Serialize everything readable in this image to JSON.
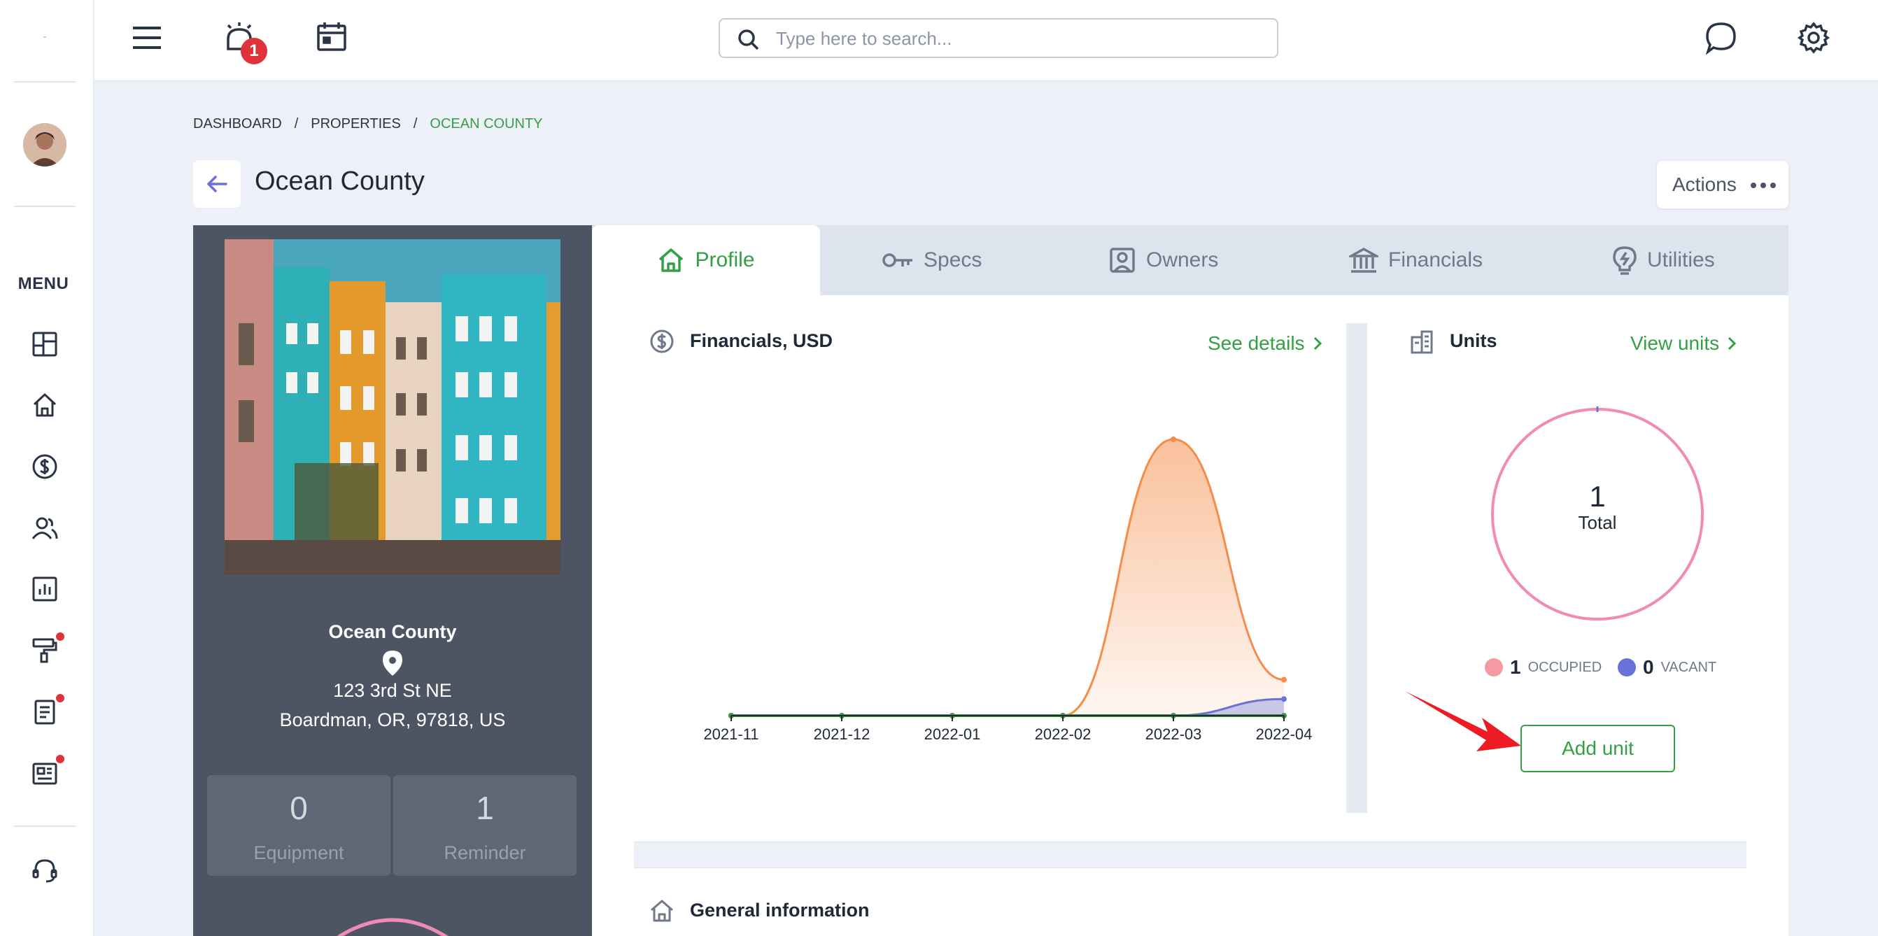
{
  "search": {
    "placeholder": "Type here to search..."
  },
  "topbar": {
    "alarm_badge": "1"
  },
  "sidebar": {
    "menu_label": "MENU",
    "items": [
      {
        "icon": "dashboard-icon"
      },
      {
        "icon": "home-icon"
      },
      {
        "icon": "dollar-icon"
      },
      {
        "icon": "users-icon"
      },
      {
        "icon": "chart-icon",
        "badge": false
      },
      {
        "icon": "paint-roller-icon",
        "badge": true
      },
      {
        "icon": "document-icon",
        "badge": true
      },
      {
        "icon": "newspaper-icon",
        "badge": true
      },
      {
        "icon": "support-icon"
      }
    ]
  },
  "breadcrumb": {
    "items": [
      "DASHBOARD",
      "PROPERTIES",
      "OCEAN COUNTY"
    ],
    "separator": "/"
  },
  "page": {
    "title": "Ocean County",
    "actions_label": "Actions"
  },
  "property": {
    "name": "Ocean County",
    "address_line1": "123 3rd St NE",
    "address_line2": "Boardman, OR, 97818, US",
    "stats": [
      {
        "value": "0",
        "label": "Equipment"
      },
      {
        "value": "1",
        "label": "Reminder"
      }
    ]
  },
  "tabs": [
    {
      "label": "Profile",
      "icon": "home-icon",
      "active": true
    },
    {
      "label": "Specs",
      "icon": "key-icon",
      "active": false
    },
    {
      "label": "Owners",
      "icon": "owner-icon",
      "active": false
    },
    {
      "label": "Financials",
      "icon": "bank-icon",
      "active": false
    },
    {
      "label": "Utilities",
      "icon": "bulb-icon",
      "active": false
    }
  ],
  "financials": {
    "title": "Financials, USD",
    "link": "See details"
  },
  "units": {
    "title": "Units",
    "link": "View units",
    "total": "1",
    "total_label": "Total",
    "occupied_count": "1",
    "occupied_label": "OCCUPIED",
    "vacant_count": "0",
    "vacant_label": "VACANT",
    "add_button": "Add unit"
  },
  "general_info": {
    "title": "General information"
  },
  "colors": {
    "accent": "#33a045",
    "orange": "#f58d4a",
    "blue": "#6a72d8",
    "pink": "#f28bb3",
    "occupied": "#f39aa3"
  },
  "chart_data": {
    "type": "area",
    "x": [
      "2021-11",
      "2021-12",
      "2022-01",
      "2022-02",
      "2022-03",
      "2022-04"
    ],
    "series": [
      {
        "values": [
          0,
          0,
          0,
          0,
          100,
          13
        ],
        "color": "#f58d4a"
      },
      {
        "values": [
          0,
          0,
          0,
          0,
          0,
          6
        ],
        "color": "#6a72d8"
      },
      {
        "values": [
          0,
          0,
          0,
          0,
          0,
          0
        ],
        "color": "#3c9a3c"
      }
    ],
    "title": "",
    "xlabel": "",
    "ylabel": "",
    "grid": false
  }
}
